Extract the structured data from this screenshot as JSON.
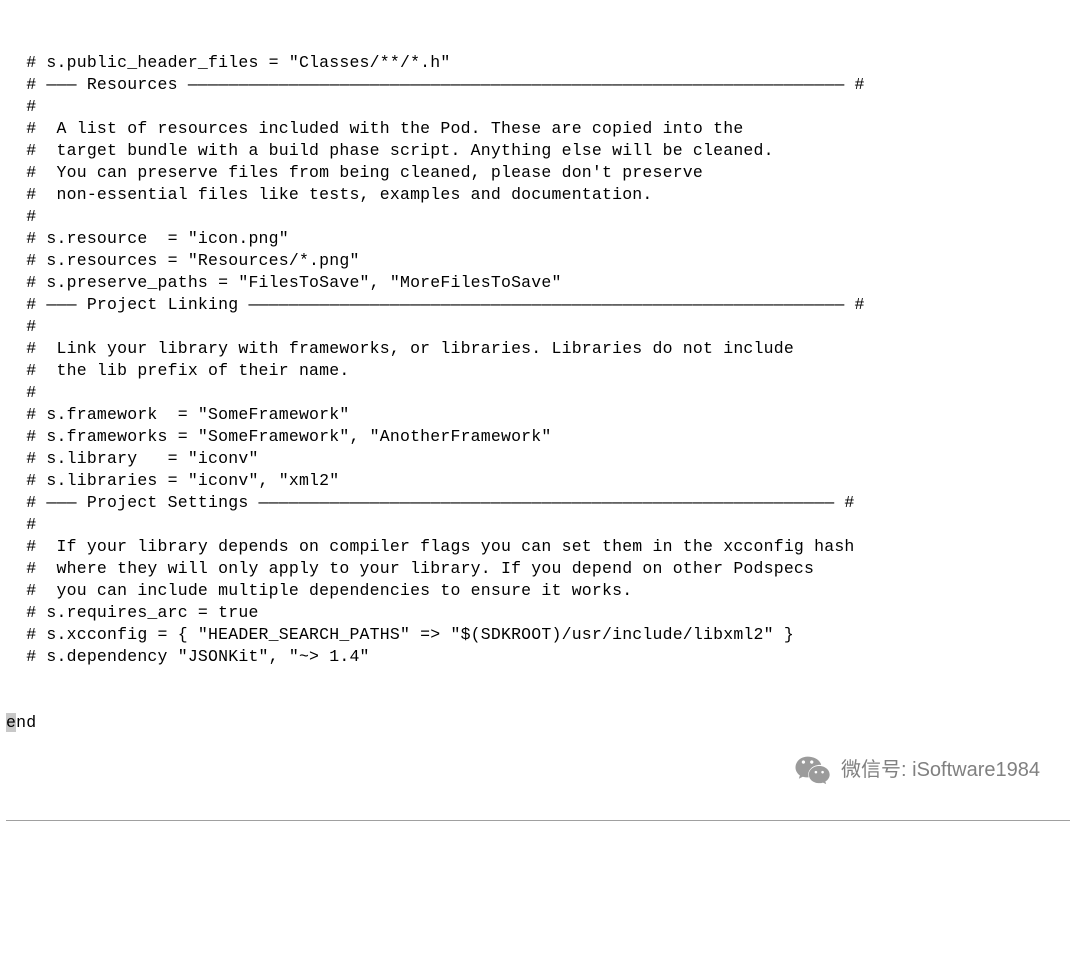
{
  "lines": [
    "  # s.public_header_files = \"Classes/**/*.h\"",
    "",
    "",
    "  # ――― Resources ――――――――――――――――――――――――――――――――――――――――――――――――――――――――――――――――― #",
    "  #",
    "  #  A list of resources included with the Pod. These are copied into the",
    "  #  target bundle with a build phase script. Anything else will be cleaned.",
    "  #  You can preserve files from being cleaned, please don't preserve",
    "  #  non-essential files like tests, examples and documentation.",
    "  #",
    "",
    "  # s.resource  = \"icon.png\"",
    "  # s.resources = \"Resources/*.png\"",
    "",
    "  # s.preserve_paths = \"FilesToSave\", \"MoreFilesToSave\"",
    "",
    "",
    "  # ――― Project Linking ――――――――――――――――――――――――――――――――――――――――――――――――――――――――――― #",
    "  #",
    "  #  Link your library with frameworks, or libraries. Libraries do not include",
    "  #  the lib prefix of their name.",
    "  #",
    "",
    "  # s.framework  = \"SomeFramework\"",
    "  # s.frameworks = \"SomeFramework\", \"AnotherFramework\"",
    "",
    "  # s.library   = \"iconv\"",
    "  # s.libraries = \"iconv\", \"xml2\"",
    "",
    "",
    "  # ――― Project Settings ――――――――――――――――――――――――――――――――――――――――――――――――――――――――― #",
    "  #",
    "  #  If your library depends on compiler flags you can set them in the xcconfig hash",
    "  #  where they will only apply to your library. If you depend on other Podspecs",
    "  #  you can include multiple dependencies to ensure it works.",
    "",
    "  # s.requires_arc = true",
    "",
    "  # s.xcconfig = { \"HEADER_SEARCH_PATHS\" => \"$(SDKROOT)/usr/include/libxml2\" }",
    "  # s.dependency \"JSONKit\", \"~> 1.4\"",
    ""
  ],
  "end_token_highlight": "e",
  "end_token_rest": "nd",
  "watermark": {
    "text": "微信号: iSoftware1984"
  }
}
